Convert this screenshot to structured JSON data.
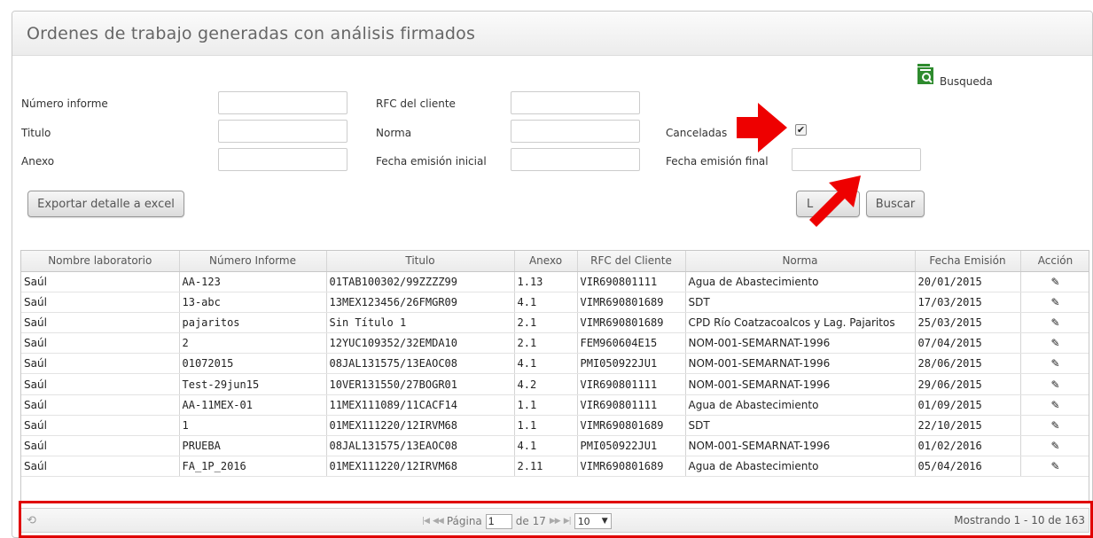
{
  "panel": {
    "title": "Ordenes de trabajo generadas con análisis firmados"
  },
  "search": {
    "label": "Busqueda",
    "icon": "search-report-icon",
    "icon_color": "#2e8b2e"
  },
  "filters": {
    "numero_informe": "Número informe",
    "titulo": "Titulo",
    "anexo": "Anexo",
    "rfc_cliente": "RFC del cliente",
    "norma": "Norma",
    "fecha_emision_inicial": "Fecha emisión inicial",
    "canceladas": "Canceladas",
    "canceladas_checked": true,
    "fecha_emision_final": "Fecha emisión final"
  },
  "buttons": {
    "export": "Exportar detalle a excel",
    "clear": "Limpiar",
    "clear_visible": "L",
    "search": "Buscar"
  },
  "annotation_color": "#e00000",
  "table": {
    "headers": [
      "Nombre laboratorio",
      "Número Informe",
      "Titulo",
      "Anexo",
      "RFC del Cliente",
      "Norma",
      "Fecha Emisión",
      "Acción"
    ],
    "rows": [
      [
        "Saúl",
        "AA-123",
        "01TAB100302/99ZZZZ99",
        "1.13",
        "VIR690801111",
        "Agua de Abastecimiento",
        "20/01/2015"
      ],
      [
        "Saúl",
        "13-abc",
        "13MEX123456/26FMGR09",
        "4.1",
        "VIMR690801689",
        "SDT",
        "17/03/2015"
      ],
      [
        "Saúl",
        "pajaritos",
        "Sin Título 1",
        "2.1",
        "VIMR690801689",
        "CPD Río Coatzacoalcos y Lag. Pajaritos",
        "25/03/2015"
      ],
      [
        "Saúl",
        "2",
        "12YUC109352/32EMDA10",
        "2.1",
        "FEM960604E15",
        "NOM-001-SEMARNAT-1996",
        "07/04/2015"
      ],
      [
        "Saúl",
        "01072015",
        "08JAL131575/13EAOC08",
        "4.1",
        "PMI050922JU1",
        "NOM-001-SEMARNAT-1996",
        "28/06/2015"
      ],
      [
        "Saúl",
        "Test-29jun15",
        "10VER131550/27BOGR01",
        "4.2",
        "VIR690801111",
        "NOM-001-SEMARNAT-1996",
        "29/06/2015"
      ],
      [
        "Saúl",
        "AA-11MEX-01",
        "11MEX111089/11CACF14",
        "1.1",
        "VIR690801111",
        "Agua de Abastecimiento",
        "01/09/2015"
      ],
      [
        "Saúl",
        "1",
        "01MEX111220/12IRVM68",
        "1.1",
        "VIMR690801689",
        "SDT",
        "22/10/2015"
      ],
      [
        "Saúl",
        "PRUEBA",
        "08JAL131575/13EAOC08",
        "4.1",
        "PMI050922JU1",
        "NOM-001-SEMARNAT-1996",
        "01/02/2016"
      ],
      [
        "Saúl",
        "FA_1P_2016",
        "01MEX111220/12IRVM68",
        "2.11",
        "VIMR690801689",
        "Agua de Abastecimiento",
        "05/04/2016"
      ]
    ],
    "action_icon": "edit-pencil-icon"
  },
  "pager": {
    "page_label": "Página",
    "page_value": "1",
    "of_label": "de 17",
    "page_size": "10",
    "summary": "Mostrando 1 - 10 de 163"
  }
}
